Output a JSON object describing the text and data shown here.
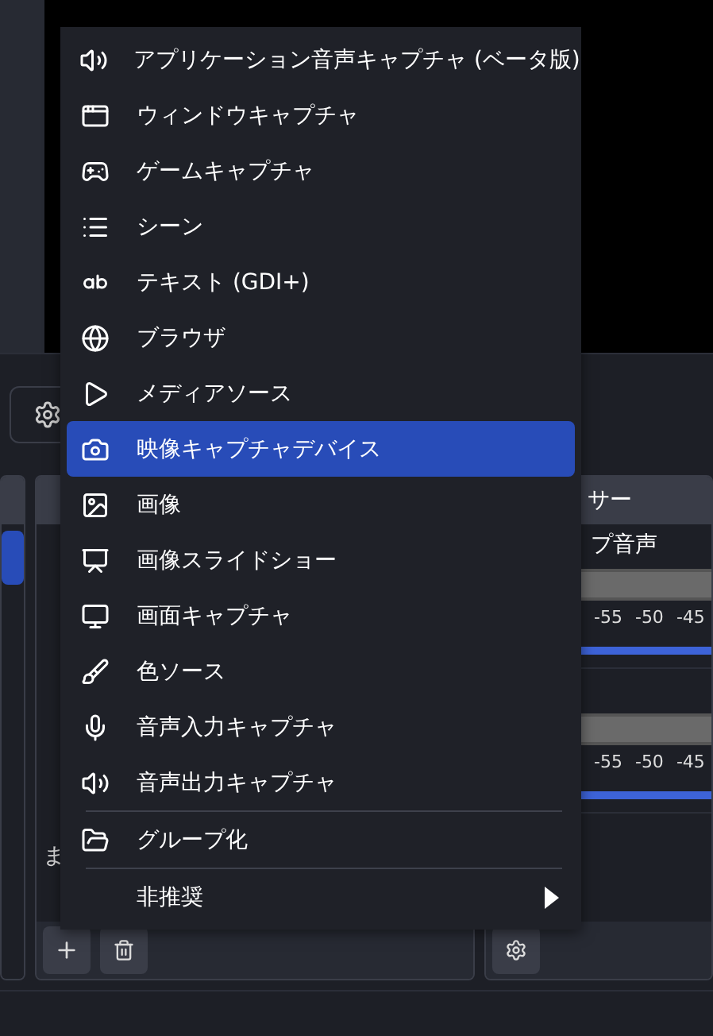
{
  "sources_panel": {
    "empty_hint": "ま"
  },
  "scenes_panel": {
    "items": [
      {
        "selected": true
      }
    ]
  },
  "mixer": {
    "title": "サー",
    "channels": [
      {
        "name": "プ音声",
        "ticks": [
          "-55",
          "-50",
          "-45"
        ],
        "level": 1
      },
      {
        "ticks": [
          "-55",
          "-50",
          "-45"
        ],
        "level": 1
      }
    ]
  },
  "menu": {
    "items": [
      {
        "kind": "item",
        "label": "アプリケーション音声キャプチャ (ベータ版)",
        "selected": false
      },
      {
        "kind": "item",
        "label": "ウィンドウキャプチャ",
        "selected": false
      },
      {
        "kind": "item",
        "label": "ゲームキャプチャ",
        "selected": false
      },
      {
        "kind": "item",
        "label": "シーン",
        "selected": false
      },
      {
        "kind": "item",
        "label": "テキスト (GDI+)",
        "selected": false
      },
      {
        "kind": "item",
        "label": "ブラウザ",
        "selected": false
      },
      {
        "kind": "item",
        "label": "メディアソース",
        "selected": false
      },
      {
        "kind": "item",
        "label": "映像キャプチャデバイス",
        "selected": true
      },
      {
        "kind": "item",
        "label": "画像",
        "selected": false
      },
      {
        "kind": "item",
        "label": "画像スライドショー",
        "selected": false
      },
      {
        "kind": "item",
        "label": "画面キャプチャ",
        "selected": false
      },
      {
        "kind": "item",
        "label": "色ソース",
        "selected": false
      },
      {
        "kind": "item",
        "label": "音声入力キャプチャ",
        "selected": false
      },
      {
        "kind": "item",
        "label": "音声出力キャプチャ",
        "selected": false
      },
      {
        "kind": "separator"
      },
      {
        "kind": "item",
        "label": "グループ化",
        "selected": false
      },
      {
        "kind": "separator"
      },
      {
        "kind": "submenu",
        "label": "非推奨",
        "selected": false
      }
    ]
  }
}
